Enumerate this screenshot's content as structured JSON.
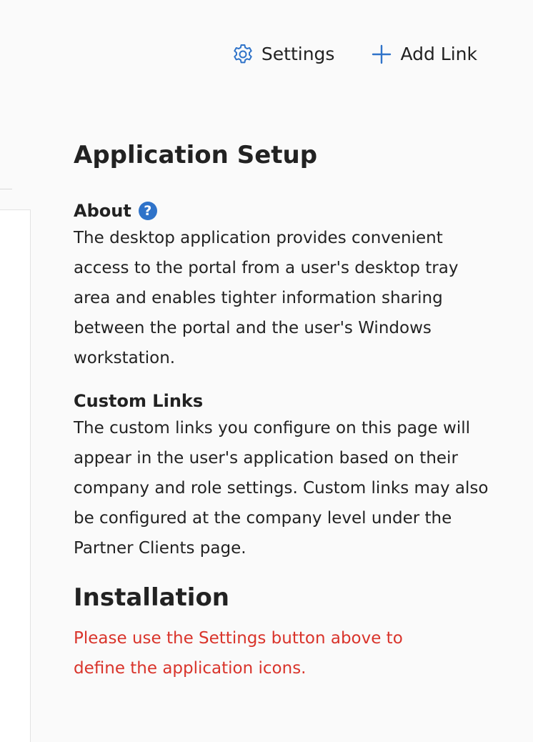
{
  "toolbar": {
    "settings_label": "Settings",
    "add_link_label": "Add Link",
    "settings_icon": "gear-icon",
    "add_link_icon": "plus-icon"
  },
  "panel": {
    "title": "Application Setup",
    "about": {
      "heading": "About",
      "help_icon": "question-circle-icon",
      "text": "The desktop application provides convenient access to the portal from a user's desktop tray area and enables tighter information sharing between the portal and the user's Windows workstation."
    },
    "custom_links": {
      "heading": "Custom Links",
      "text": "The custom links you configure on this page will appear in the user's application based on their company and role settings. Custom links may also be configured at the company level under the Partner Clients page."
    },
    "installation": {
      "heading": "Installation",
      "warning": "Please use the Settings button above to define the application icons."
    }
  },
  "colors": {
    "accent": "#2f73c9",
    "warning": "#d9342b",
    "text": "#222222",
    "background": "#fafafa"
  }
}
